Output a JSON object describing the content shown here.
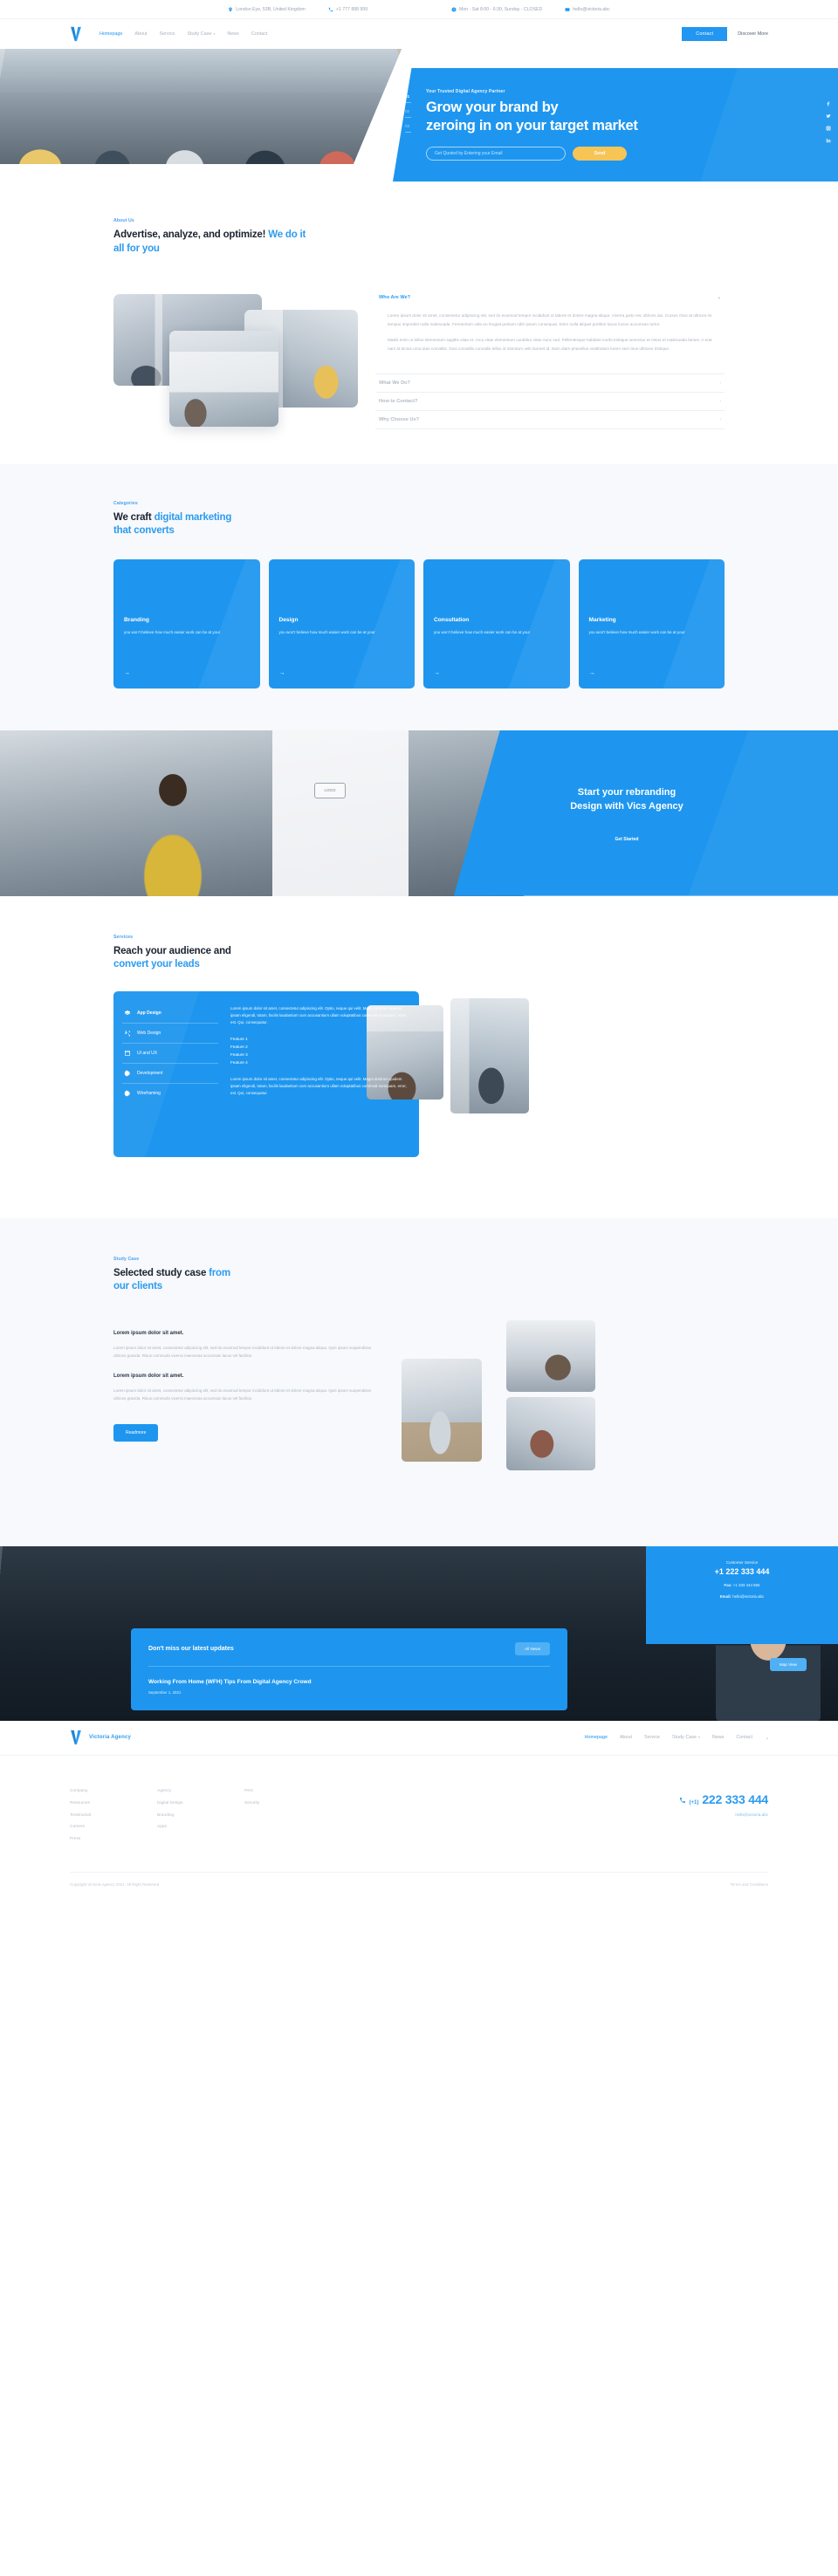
{
  "topbar": {
    "address": "London Eye, 53B, United Kingdom",
    "phone": "+1 777 888 999",
    "hours": "Mon - Sat 8:00 - 6:30, Sunday - CLOSED",
    "email": "hello@victoria.abc"
  },
  "nav": {
    "links": [
      "Homepage",
      "About",
      "Service",
      "Study Case",
      "News",
      "Contact"
    ],
    "contact_button": "Contact",
    "discover_link": "Discover More"
  },
  "hero": {
    "eyebrow": "Your Trusted Digital Agency Partner",
    "title_line1": "Grow your brand by",
    "title_line2": "zeroing in on your target market",
    "email_placeholder": "Get Quoted by Entering your Email",
    "send_label": "Send",
    "counters": [
      "01",
      "02",
      "03"
    ]
  },
  "about": {
    "eyebrow": "About Us",
    "title_dark": "Advertise, analyze, and optimize!",
    "title_blue_1": "We do it",
    "title_blue_2": "all for you",
    "accordion": [
      {
        "title": "Who Are We?",
        "open": true,
        "paragraphs": [
          "Lorem ipsum dolor sit amet, consectetur adipiscing elit, sed do eiusmod tempor incididunt ut labore et dolore magna aliqua. Viverra justo nec ultrices dui. Cursus risus at ultrices mi tempus imperdiet nulla malesuada. Fermentum odio eu feugiat pretium nibh ipsum consequat. Enim nulla aliquet porttitor lacus luctus accumsan tortor.",
          "Mattis enim ut tellus elementum sagittis vitae et. Arcu vitae elementum curabitur vitae nunc sed. Pellentesque habitant morbi tristique senectus et netus et malesuada fames. A erat nam at lectus urna duis convallis. Duis convallis convallis tellus id interdum velit laoreet id. Nam diam phasellus vestibulum lorem sed risus ultricies tristique."
        ]
      },
      {
        "title": "What We Do?",
        "open": false,
        "paragraphs": []
      },
      {
        "title": "How to Contact?",
        "open": false,
        "paragraphs": []
      },
      {
        "title": "Why Choose Us?",
        "open": false,
        "paragraphs": []
      }
    ]
  },
  "categories": {
    "eyebrow": "Categories",
    "title_dark": "We craft",
    "title_blue_1": "digital marketing",
    "title_blue_2": "that converts",
    "cards": [
      {
        "title": "Branding",
        "text": "you won't believe how much easier work can be at your",
        "arrow": "→"
      },
      {
        "title": "Design",
        "text": "you won't believe how much easier work can be at your",
        "arrow": "→"
      },
      {
        "title": "Consultation",
        "text": "you won't believe how much easier work can be at your",
        "arrow": "→"
      },
      {
        "title": "Marketing",
        "text": "you won't believe how much easier work can be at your",
        "arrow": "→"
      }
    ]
  },
  "rebrand": {
    "title_line1": "Start your rebranding",
    "title_line2": "Design with Vics Agency",
    "button": "Get Started",
    "logo_placeholder": "LOGO"
  },
  "services": {
    "eyebrow": "Services",
    "title_dark": "Reach your audience and",
    "title_blue": "convert your leads",
    "tabs": [
      {
        "label": "App Design",
        "icon": "layers-icon",
        "active": true
      },
      {
        "label": "Web Design",
        "icon": "shuffle-icon",
        "active": false
      },
      {
        "label": "UI and UX",
        "icon": "window-icon",
        "active": false
      },
      {
        "label": "Development",
        "icon": "contrast-icon",
        "active": false
      },
      {
        "label": "Wireframing",
        "icon": "contrast-icon",
        "active": false
      }
    ],
    "paragraph_top": "Lorem ipsum dolor sit amet, consectetur adipiscing elit. Optio, neque qui velit. Magni dolorum quidem ipsam eligendi, totam, facilis laudantium cum accusantium ullam voluptatibus commodi numquam, error, est. Qui, consequatur.",
    "features": [
      "Feature 1",
      "Feature 2",
      "Feature 3",
      "Feature 4"
    ],
    "paragraph_bottom": "Lorem ipsum dolor sit amet, consectetur adipiscing elit. Optio, neque qui velit. Magni dolorum quidem ipsam eligendi, totam, facilis laudantium cum accusantium ullam voluptatibus commodi numquam, error, est. Qui, consequatur."
  },
  "study": {
    "eyebrow": "Study Case",
    "title_dark": "Selected study case",
    "title_blue_1": "from",
    "title_blue_2": "our clients",
    "items": [
      {
        "heading": "Lorem ipsum dolor sit amet.",
        "text": "Lorem ipsum dolor sit amet, consectetur adipiscing elit, sed do eiusmod tempor incididunt ut labore et dolore magna aliqua. Quis ipsum suspendisse ultrices gravida. Risus commodo viverra maecenas accumsan lacus vel facilisis."
      },
      {
        "heading": "Lorem ipsum dolor sit amet.",
        "text": "Lorem ipsum dolor sit amet, consectetur adipiscing elit, sed do eiusmod tempor incididunt ut labore et dolore magna aliqua. Quis ipsum suspendisse ultrices gravida. Risus commodo viverra maecenas accumsan lacus vel facilisis."
      }
    ],
    "button": "Readmore"
  },
  "band": {
    "customer_service_label": "Customer Service",
    "phone": "+1 222 333 444",
    "fax_label": "Fax:",
    "fax": "+1 333 444 555",
    "email_label": "Email:",
    "email": "hello@victoria.abc",
    "news_title": "Don't miss our latest updates",
    "all_news_button": "All News",
    "map_button": "Map View",
    "article_title": "Working From Home (WFH) Tips From Digital Agency Crowd",
    "article_date": "September 1, 2021"
  },
  "footer": {
    "brand": "Victoria Agency",
    "links": [
      "Homepage",
      "About",
      "Service",
      "Study Case",
      "News",
      "Contact"
    ],
    "columns": [
      [
        "Company",
        "Resources",
        "Testimonial",
        "Careers",
        "Press"
      ],
      [
        "Agency",
        "Digital Design",
        "Branding",
        "Apps"
      ],
      [
        "Pers",
        "Security"
      ]
    ],
    "phone_prefix": "(+1)",
    "phone_number": "222 333 444",
    "email": "hello@victoria.abc",
    "copyright": "Copyright Victoria Agency 2021. All Right Reserved",
    "terms": "Terms and Conditions"
  },
  "colors": {
    "accent": "#1e96ef",
    "accent_light": "#4aa3f0",
    "yellow": "#f7c456",
    "muted": "#aab3bf"
  }
}
